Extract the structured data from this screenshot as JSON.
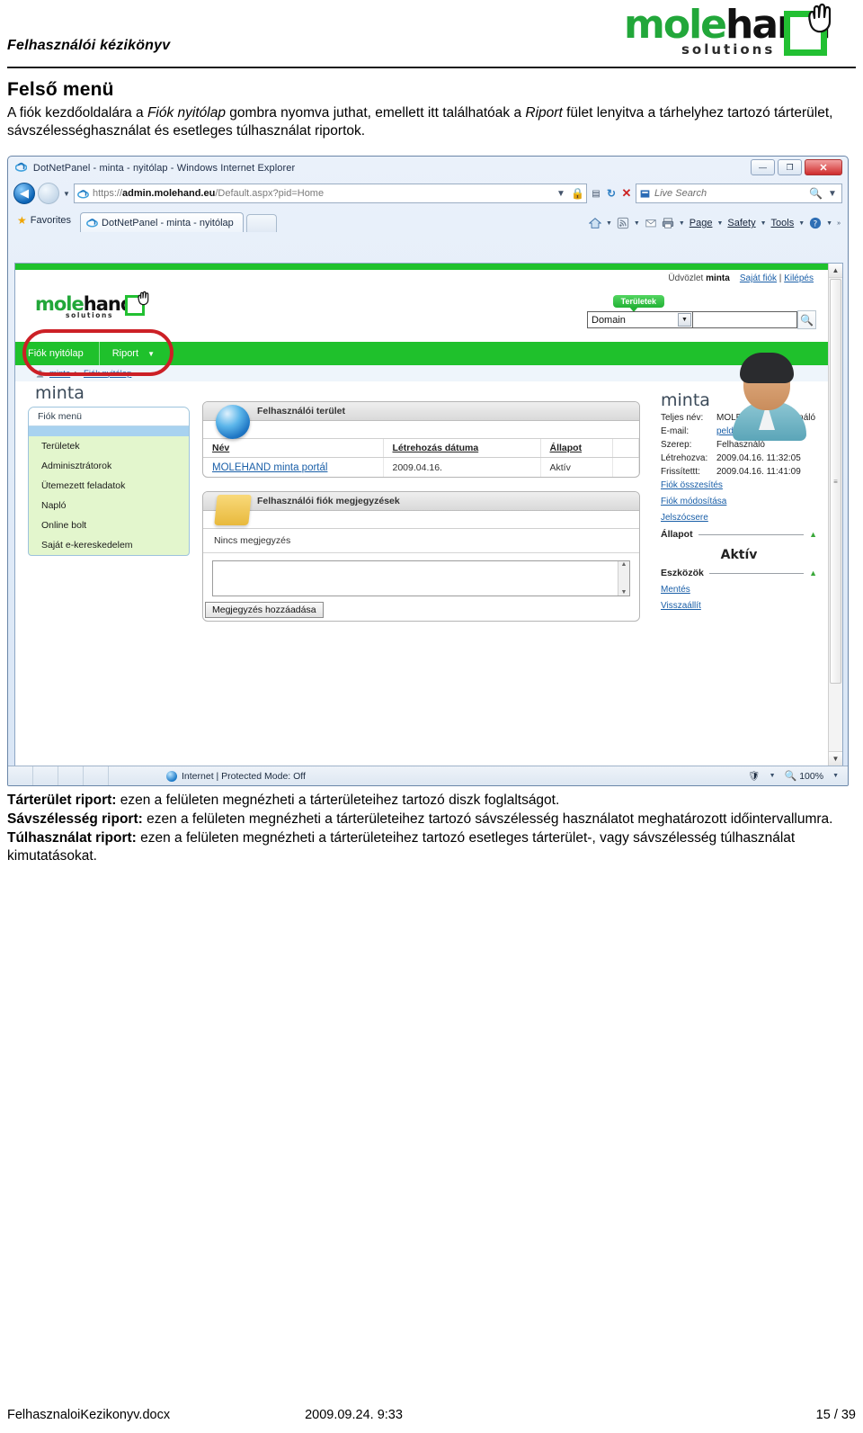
{
  "document": {
    "header_title": "Felhasználói kézikönyv",
    "logo": {
      "part1": "mole",
      "part2": "hand",
      "sub": "solutions"
    },
    "section_title": "Felső menü",
    "intro_line1_a": "A fiók kezdőoldalára a ",
    "intro_line1_em1": "Fiók nyitólap",
    "intro_line1_b": " gombra nyomva juthat, emellett itt találhatóak a ",
    "intro_line1_em2": "Riport",
    "intro_line1_c": " fület",
    "intro_line2": "lenyitva a tárhelyhez tartozó tárterület, sávszélességhasználat és esetleges túlhasználat riportok."
  },
  "browser": {
    "window_title": "DotNetPanel - minta - nyitólap - Windows Internet Explorer",
    "window_buttons": {
      "minimize": "—",
      "maximize": "❐",
      "close": "✕"
    },
    "address": {
      "scheme": "https://",
      "host_strong": "admin.molehand.eu",
      "path": "/Default.aspx?pid=Home",
      "full": "https://admin.molehand.eu/Default.aspx?pid=Home"
    },
    "search_placeholder": "Live Search",
    "favorites_label": "Favorites",
    "tab_title": "DotNetPanel - minta - nyitólap",
    "command_bar": [
      "Page",
      "Safety",
      "Tools"
    ],
    "status": {
      "zone": "Internet | Protected Mode: Off",
      "zoom": "100%"
    }
  },
  "site": {
    "logo": {
      "part1": "mole",
      "part2": "hand",
      "sub": "solutions"
    },
    "welcome_prefix": "Üdvözlet ",
    "welcome_user": "minta",
    "link_my_accounts": "Saját fiók",
    "link_logout": "Kilépés",
    "tooltip_areas": "Területek",
    "search_select_value": "Domain",
    "search_input_value": "",
    "nav_tabs": [
      {
        "label": "Fiók nyitólap",
        "has_caret": false
      },
      {
        "label": "Riport",
        "has_caret": true
      }
    ],
    "breadcrumb": [
      "minta",
      "Fiók nyitólap"
    ],
    "page_title": "minta",
    "account_menu": {
      "header": "Fiók menü",
      "items": [
        "Területek",
        "Adminisztrátorok",
        "Ütemezett feladatok",
        "Napló",
        "Online bolt",
        "Saját e-kereskedelem"
      ]
    },
    "panel_user_area": {
      "title": "Felhasználói terület",
      "columns": [
        "Név",
        "Létrehozás dátuma",
        "Állapot"
      ],
      "rows": [
        {
          "nev": "MOLEHAND minta portál",
          "datum": "2009.04.16.",
          "allapot": "Aktív"
        }
      ]
    },
    "panel_notes": {
      "title": "Felhasználói fiók megjegyzések",
      "empty_text": "Nincs megjegyzés",
      "textarea_value": "",
      "add_button": "Megjegyzés hozzáadása"
    },
    "account_info": {
      "name": "minta",
      "fields": [
        {
          "label": "Teljes név:",
          "value": "MOLEHAND felhasználó",
          "is_link": false
        },
        {
          "label": "E-mail:",
          "value": "pelda@molehand.eu",
          "is_link": true
        },
        {
          "label": "Szerep:",
          "value": "Felhasználó",
          "is_link": false
        },
        {
          "label": "Létrehozva:",
          "value": "2009.04.16. 11:32:05",
          "is_link": false
        },
        {
          "label": "Frissítettt:",
          "value": "2009.04.16. 11:41:09",
          "is_link": false
        }
      ],
      "links": [
        "Fiók összesítés",
        "Fiók módosítása",
        "Jelszócsere"
      ],
      "status_section_label": "Állapot",
      "status_value": "Aktív",
      "tools_section_label": "Eszközök",
      "tool_links": [
        "Mentés",
        "Visszaállít"
      ]
    }
  },
  "descriptions": [
    {
      "bold": "Tárterület riport:",
      "text": " ezen a felületen megnézheti a tárterületeihez tartozó diszk foglaltságot."
    },
    {
      "bold": "Sávszélesség riport:",
      "text": " ezen a felületen megnézheti a tárterületeihez tartozó sávszélesség használatot meghatározott időintervallumra."
    },
    {
      "bold": "Túlhasználat riport:",
      "text": " ezen a felületen megnézheti a tárterületeihez tartozó esetleges tárterület-, vagy sávszélesség túlhasználat kimutatásokat."
    }
  ],
  "footer": {
    "filename": "FelhasznaloiKezikonyv.docx",
    "date": "2009.09.24. 9:33",
    "page": "15 / 39"
  },
  "colors": {
    "brand_green": "#22c032",
    "nav_green": "#1fc12c",
    "link_blue": "#1a5fa8",
    "highlight_red": "#cc2026"
  }
}
